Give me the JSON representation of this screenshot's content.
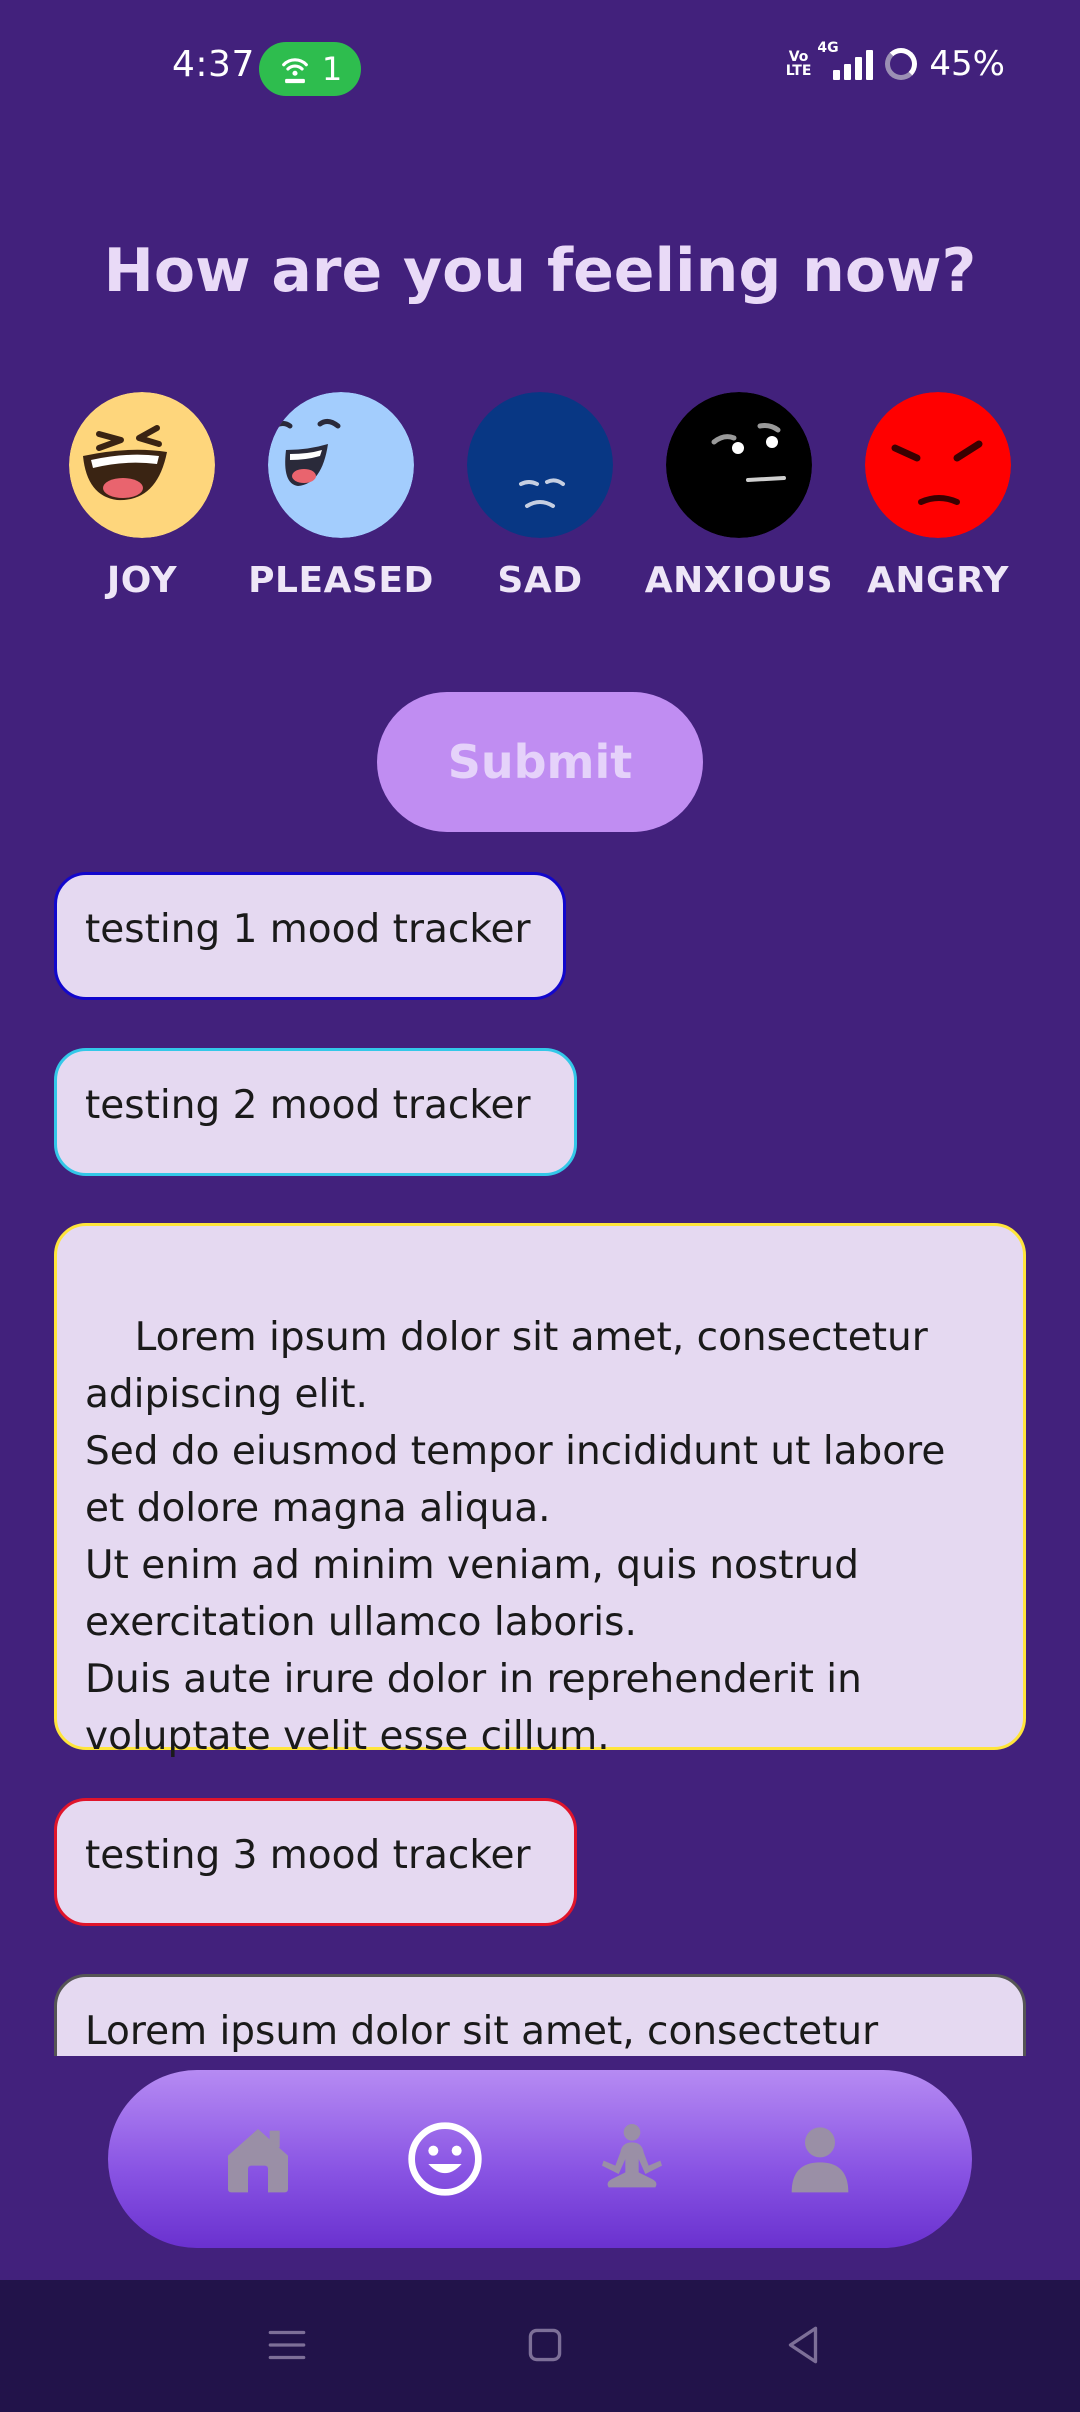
{
  "status_bar": {
    "time": "4:37",
    "hotspot_count": "1",
    "network_label": "Vo LTE",
    "network_type": "4G",
    "battery": "45%"
  },
  "title": "How are you feeling now?",
  "moods": [
    {
      "label": "JOY",
      "color": "#fed67c",
      "icon": "laughing-face-icon"
    },
    {
      "label": "PLEASED",
      "color": "#a3cdfd",
      "icon": "smiling-face-icon"
    },
    {
      "label": "SAD",
      "color": "#083784",
      "icon": "sad-face-icon"
    },
    {
      "label": "ANXIOUS",
      "color": "#000000",
      "icon": "worried-face-icon"
    },
    {
      "label": "ANGRY",
      "color": "#ff0000",
      "icon": "angry-face-icon"
    }
  ],
  "submit_label": "Submit",
  "entries": [
    {
      "text": "testing 1 mood tracker",
      "border_color": "#1207cc"
    },
    {
      "text": "testing 2 mood tracker",
      "border_color": "#33c8e8"
    },
    {
      "text": "Lorem ipsum dolor sit amet, consectetur adipiscing elit.\nSed do eiusmod tempor incididunt ut labore et dolore magna aliqua.\nUt enim ad minim veniam, quis nostrud exercitation ullamco laboris.\nDuis aute irure dolor in reprehenderit in voluptate velit esse cillum.",
      "border_color": "#ffe53b"
    },
    {
      "text": "testing 3 mood tracker",
      "border_color": "#e0142b"
    },
    {
      "text": "Lorem ipsum dolor sit amet, consectetur",
      "border_color": "#555555"
    }
  ],
  "bottom_nav": [
    {
      "icon": "home-icon",
      "active": false
    },
    {
      "icon": "mood-icon",
      "active": true
    },
    {
      "icon": "meditation-icon",
      "active": false
    },
    {
      "icon": "profile-icon",
      "active": false
    }
  ],
  "colors": {
    "background": "#42217c",
    "accent": "#c08df2",
    "entry_background": "#e5d9f1",
    "nav_inactive": "#9a8fa6",
    "nav_active": "#ffffff"
  }
}
